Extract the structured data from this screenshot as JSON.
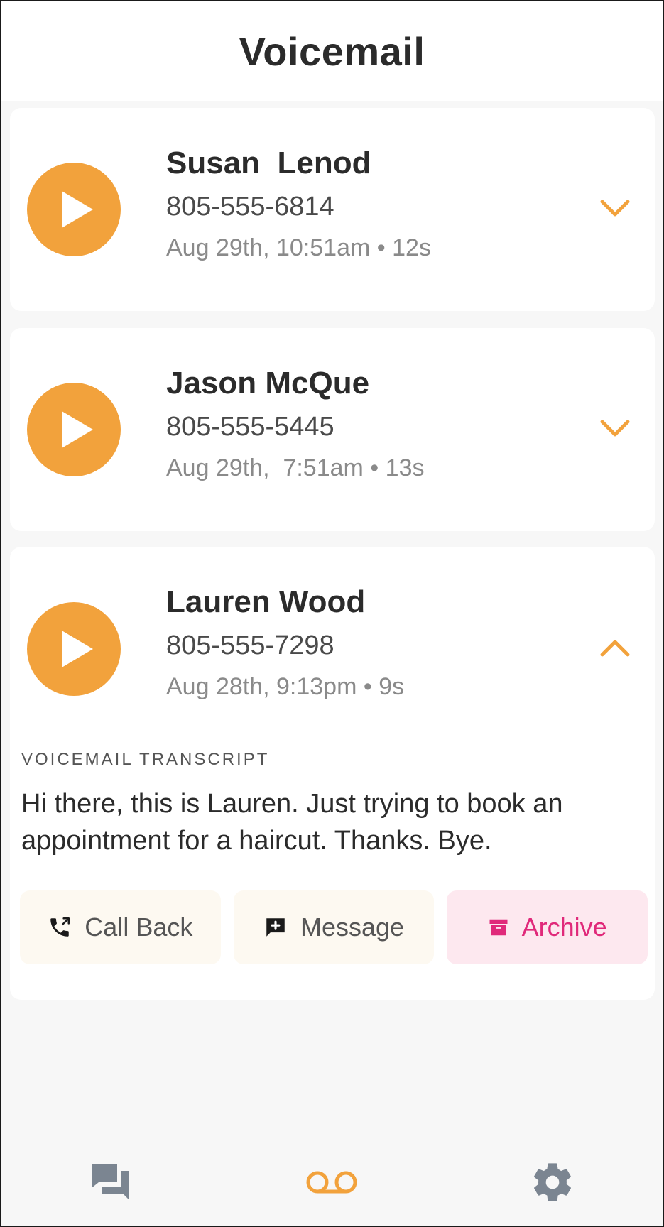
{
  "header": {
    "title": "Voicemail"
  },
  "voicemails": [
    {
      "name": "Susan  Lenod",
      "phone": "805-555-6814",
      "meta": "Aug 29th, 10:51am • 12s",
      "expanded": false
    },
    {
      "name": "Jason McQue",
      "phone": "805-555-5445",
      "meta": "Aug 29th,  7:51am • 13s",
      "expanded": false
    },
    {
      "name": "Lauren Wood",
      "phone": "805-555-7298",
      "meta": "Aug 28th, 9:13pm • 9s",
      "expanded": true
    }
  ],
  "transcript": {
    "label": "VOICEMAIL TRANSCRIPT",
    "text": "Hi there, this is Lauren. Just trying to book an appointment for a haircut. Thanks. Bye."
  },
  "actions": {
    "call_back": "Call Back",
    "message": "Message",
    "archive": "Archive"
  },
  "colors": {
    "accent": "#f2a23c",
    "archive": "#e0297a",
    "nav_icon": "#7b8591"
  },
  "nav": {
    "items": [
      {
        "icon": "chat-icon",
        "active": false
      },
      {
        "icon": "voicemail-icon",
        "active": true
      },
      {
        "icon": "gear-icon",
        "active": false
      }
    ]
  }
}
